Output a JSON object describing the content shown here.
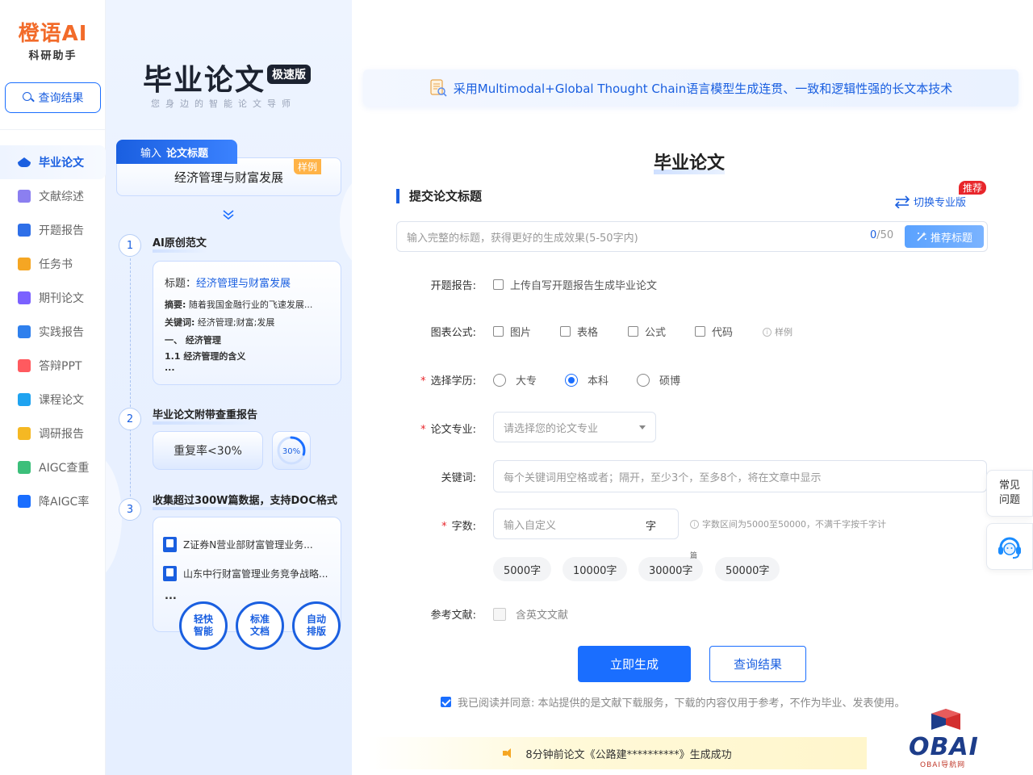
{
  "sidebar": {
    "brand": "橙语AI",
    "brand_sub": "科研助手",
    "query_button": "查询结果",
    "items": [
      {
        "label": "毕业论文",
        "color": "#1a5fe0",
        "active": true
      },
      {
        "label": "文献综述",
        "color": "#8b7ff0"
      },
      {
        "label": "开题报告",
        "color": "#2e6fe8"
      },
      {
        "label": "任务书",
        "color": "#f5a623"
      },
      {
        "label": "期刊论文",
        "color": "#7b61ff"
      },
      {
        "label": "实践报告",
        "color": "#2f80ed"
      },
      {
        "label": "答辩PPT",
        "color": "#ff5a5f"
      },
      {
        "label": "课程论文",
        "color": "#1fa3f0"
      },
      {
        "label": "调研报告",
        "color": "#f5b823"
      },
      {
        "label": "AIGC查重",
        "color": "#3cbf7a"
      },
      {
        "label": "降AIGC率",
        "color": "#1a6eff"
      }
    ]
  },
  "promo": {
    "title": "毕业论文",
    "badge": "极速版",
    "subtitle": "您身边的智能论文导师",
    "input_tab_prefix": "输入",
    "input_tab_label": "论文标题",
    "input_value": "经济管理与财富发展",
    "sample_tag": "样例",
    "step1": {
      "num": "1",
      "title": "AI原创范文",
      "title_label": "标题：",
      "title_value": "经济管理与财富发展",
      "abstract_label": "摘要:",
      "abstract_text": "随着我国金融行业的飞速发展...",
      "keywords_label": "关键词:",
      "keywords_text": "经济管理;财富;发展",
      "heading1": "一、 经济管理",
      "heading2": "1.1 经济管理的含义",
      "more": "..."
    },
    "step2": {
      "num": "2",
      "title": "毕业论文附带查重报告",
      "rate_label": "重复率<30%",
      "ring_value": "30%",
      "ring_fraction": 0.3
    },
    "step3": {
      "num": "3",
      "title": "收集超过300W篇数据，支持DOC格式",
      "docs": [
        "Z证券N营业部财富管理业务...",
        "山东中行财富管理业务竞争战略..."
      ],
      "more": "...",
      "features": [
        {
          "l1": "轻快",
          "l2": "智能"
        },
        {
          "l1": "标准",
          "l2": "文档"
        },
        {
          "l1": "自动",
          "l2": "排版"
        }
      ]
    }
  },
  "main": {
    "banner": "采用Multimodal+Global Thought Chain语言模型生成连贯、一致和逻辑性强的长文本技术",
    "title": "毕业论文",
    "section_title": "提交论文标题",
    "switch_label": "切换专业版",
    "hot_badge": "推荐",
    "title_input": {
      "placeholder": "输入完整的标题，获得更好的生成效果(5-50字内)",
      "count": "0",
      "max": "/50"
    },
    "recommend_button": "推荐标题",
    "proposal": {
      "label": "开题报告:",
      "option": "上传自写开题报告生成毕业论文"
    },
    "charts": {
      "label": "图表公式:",
      "options": [
        "图片",
        "表格",
        "公式",
        "代码"
      ],
      "sample": "样例"
    },
    "degree": {
      "label": "选择学历:",
      "options": [
        "大专",
        "本科",
        "硕博"
      ],
      "selected": "本科"
    },
    "major": {
      "label": "论文专业:",
      "placeholder": "请选择您的论文专业"
    },
    "keywords": {
      "label": "关键词:",
      "placeholder": "每个关键词用空格或者；隔开，至少3个，至多8个，将在文章中显示"
    },
    "wordcount": {
      "label": "字数:",
      "placeholder": "输入自定义",
      "unit": "字",
      "hint": "字数区间为5000至50000，不满千字按千字计",
      "chips": [
        "5000字",
        "10000字",
        "30000字",
        "50000字"
      ],
      "chip_tag": "篇"
    },
    "references": {
      "label": "参考文献:",
      "option": "含英文文献"
    },
    "generate_button": "立即生成",
    "query_button": "查询结果",
    "agreement": "我已阅读并同意: 本站提供的是文献下载服务，下载的内容仅用于参考，不作为毕业、发表使用。",
    "ticker": "8分钟前论文《公路建**********》生成成功"
  },
  "float": {
    "faq_l1": "常见",
    "faq_l2": "问题"
  },
  "watermark": {
    "text": "OBAI",
    "sub": "OBAI导航网"
  }
}
